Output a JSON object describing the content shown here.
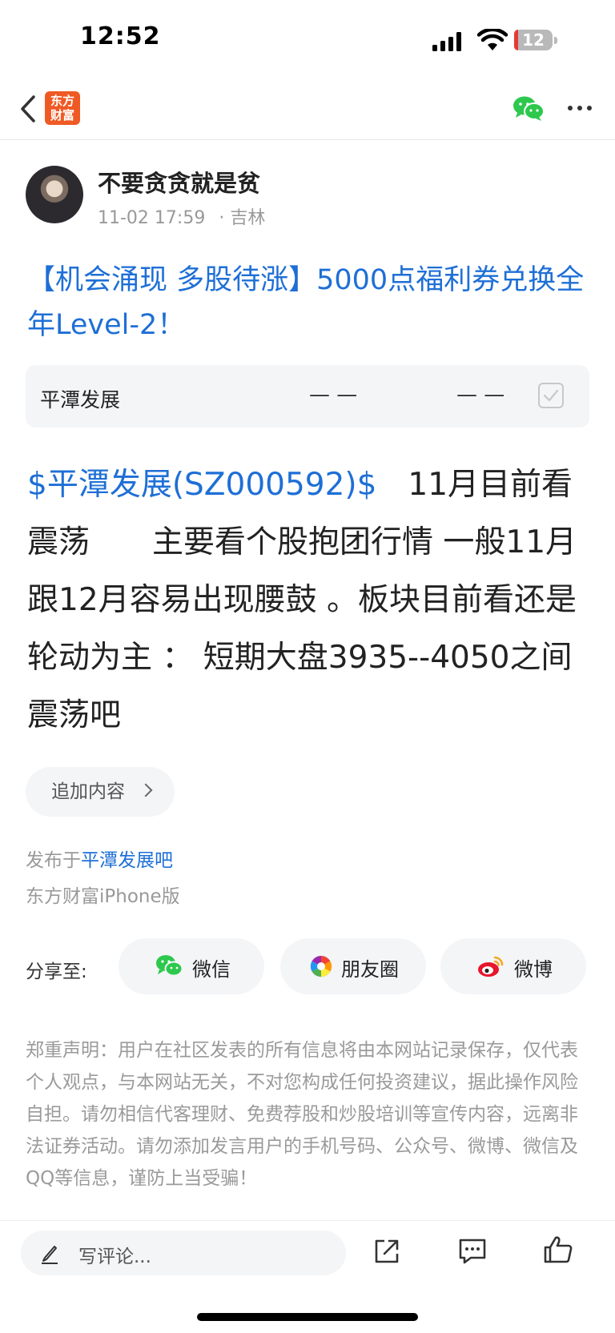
{
  "status_bar": {
    "time": "12:52",
    "battery": "12"
  },
  "nav": {
    "logo_line1": "东方",
    "logo_line2": "财富"
  },
  "author": {
    "name": "不要贪贪就是贫",
    "date": "11-02 17:59",
    "location": "· 吉林"
  },
  "post": {
    "title": "【机会涌现 多股待涨】5000点福利券兑换全年Level-2！",
    "stock_card": {
      "name": "平潭发展",
      "price": "— —",
      "change": "— —"
    },
    "body_link": "$平潭发展(SZ000592)$",
    "body_text": "　11月目前看震荡　　主要看个股抱团行情 一般11月跟12月容易出现腰鼓 。板块目前看还是轮动为主 ： 短期大盘3935--4050之间震荡吧",
    "append_label": "追加内容",
    "posted_prefix": "发布于",
    "posted_bar": "平潭发展吧",
    "client": "东方财富iPhone版"
  },
  "share": {
    "label": "分享至:",
    "wechat": "微信",
    "moments": "朋友圈",
    "weibo": "微博"
  },
  "disclaimer": "郑重声明：用户在社区发表的所有信息将由本网站记录保存，仅代表个人观点，与本网站无关，不对您构成任何投资建议，据此操作风险自担。请勿相信代客理财、免费荐股和炒股培训等宣传内容，远离非法证券活动。请勿添加发言用户的手机号码、公众号、微博、微信及QQ等信息，谨防上当受骗！",
  "bottom_bar": {
    "comment_placeholder": "写评论..."
  },
  "colors": {
    "link": "#1e6fd6",
    "brand": "#ef5a24",
    "wechat": "#2dc84d"
  }
}
